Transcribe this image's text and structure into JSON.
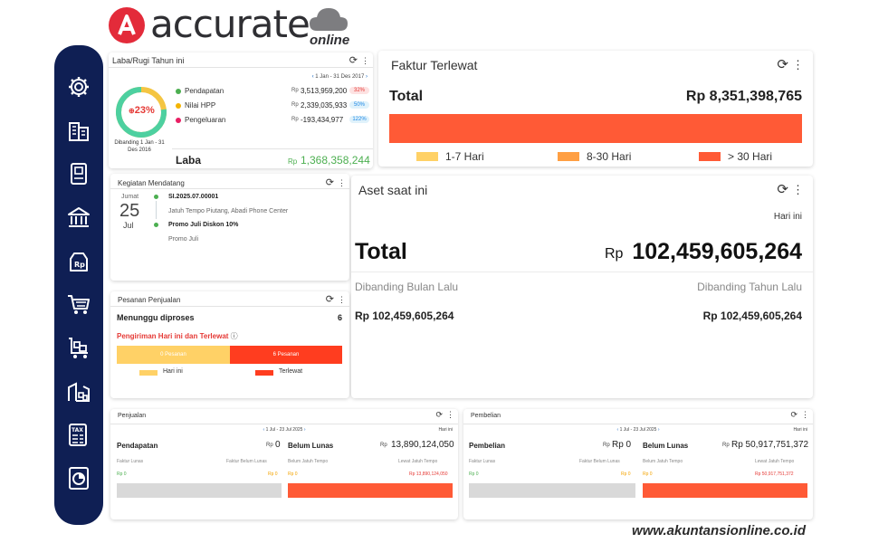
{
  "brand": {
    "name": "accurate",
    "sub": "online",
    "color": "#e32b3a"
  },
  "colors": {
    "sidebar": "#0f1f54",
    "orange_red": "#ff5a36",
    "yellow": "#ffd166",
    "orange": "#ff9f43",
    "green": "#4caf50",
    "red": "#e53935"
  },
  "sidebar": {
    "items": [
      {
        "icon": "gear-icon"
      },
      {
        "icon": "building-icon"
      },
      {
        "icon": "book-icon"
      },
      {
        "icon": "bank-icon"
      },
      {
        "icon": "price-tag-icon"
      },
      {
        "icon": "cart-icon"
      },
      {
        "icon": "inventory-cart-icon"
      },
      {
        "icon": "warehouse-icon"
      },
      {
        "icon": "tax-document-icon"
      },
      {
        "icon": "report-chart-icon"
      }
    ]
  },
  "laba_rugi": {
    "title": "Laba/Rugi Tahun ini",
    "period": "1 Jan - 31 Des 2017",
    "percent": "23%",
    "percent_value": 23,
    "compare_note": "Dibanding 1 Jan - 31 Des 2016",
    "rows": [
      {
        "label": "Pendapatan",
        "rp": "Rp",
        "amount": "3,513,959,200",
        "pct": "32%",
        "color": "#4caf50",
        "pct_bg": "#fde2e2",
        "pct_color": "#e53935"
      },
      {
        "label": "Nilai HPP",
        "rp": "Rp",
        "amount": "2,339,035,933",
        "pct": "50%",
        "color": "#f4b400",
        "pct_bg": "#e0f2fb",
        "pct_color": "#1e88e5"
      },
      {
        "label": "Pengeluaran",
        "rp": "Rp",
        "amount": "-193,434,977",
        "pct": "122%",
        "color": "#e91e63",
        "pct_bg": "#e0f2fb",
        "pct_color": "#1e88e5"
      }
    ],
    "laba_label": "Laba",
    "laba_rp": "Rp",
    "laba_value": "1,368,358,244"
  },
  "faktur": {
    "title": "Faktur Terlewat",
    "total_label": "Total",
    "total_value": "Rp 8,351,398,765",
    "legend": [
      {
        "label": "1-7 Hari",
        "color": "#ffd166"
      },
      {
        "label": "8-30 Hari",
        "color": "#ff9f43"
      },
      {
        "label": "> 30 Hari",
        "color": "#ff5a36"
      }
    ]
  },
  "kegiatan": {
    "title": "Kegiatan Mendatang",
    "day_name": "Jumat",
    "day": "25",
    "month": "Jul",
    "events": [
      {
        "title": "SI.2025.07.00001",
        "sub": "Jatuh Tempo Piutang, Abadi Phone Center"
      },
      {
        "title": "Promo Juli Diskon 10%",
        "sub": "Promo Juli"
      }
    ]
  },
  "pesanan": {
    "title": "Pesanan Penjualan",
    "waiting_label": "Menunggu diproses",
    "waiting_count": "6",
    "shipping_label": "Pengiriman Hari ini dan Terlewat",
    "bar_left": "0 Pesanan",
    "bar_right": "6 Pesanan",
    "legend_left": "Hari ini",
    "legend_right": "Terlewat"
  },
  "aset": {
    "title": "Aset saat ini",
    "period": "Hari ini",
    "total_label": "Total",
    "total_rp": "Rp",
    "total_value": "102,459,605,264",
    "compare_month_label": "Dibanding Bulan Lalu",
    "compare_month_value": "Rp 102,459,605,264",
    "compare_year_label": "Dibanding Tahun Lalu",
    "compare_year_value": "Rp 102,459,605,264"
  },
  "penjualan": {
    "title": "Penjualan",
    "period": "1 Jul - 23 Jul 2025",
    "period_label": "Hari ini",
    "left_label": "Pendapatan",
    "left_rp": "Rp",
    "left_value": "0",
    "left_sub_a": "Faktur Lunas",
    "left_sub_b": "Faktur Belum Lunas",
    "left_amt_a": "Rp 0",
    "left_amt_b": "Rp 0",
    "right_label": "Belum Lunas",
    "right_rp": "Rp",
    "right_value": "13,890,124,050",
    "right_sub_a": "Belum Jatuh Tempo",
    "right_sub_b": "Lewat Jatuh Tempo",
    "right_amt_a": "Rp 0",
    "right_amt_b": "Rp 13,890,124,050"
  },
  "pembelian": {
    "title": "Pembelian",
    "period": "1 Jul - 23 Jul 2025",
    "period_label": "Hari ini",
    "left_label": "Pembelian",
    "left_rp": "Rp",
    "left_value": "Rp 0",
    "left_sub_a": "Faktur Lunas",
    "left_sub_b": "Faktur Belum Lunas",
    "left_amt_a": "Rp 0",
    "left_amt_b": "Rp 0",
    "right_label": "Belum Lunas",
    "right_rp": "Rp",
    "right_value": "Rp 50,917,751,372",
    "right_sub_a": "Belum Jatuh Tempo",
    "right_sub_b": "Lewat Jatuh Tempo",
    "right_amt_a": "Rp 0",
    "right_amt_b": "Rp 50,917,751,372"
  },
  "watermark": "www.akuntansionline.co.id"
}
